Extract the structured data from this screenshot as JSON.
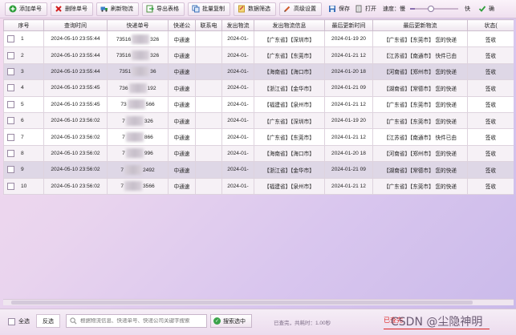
{
  "toolbar": {
    "add": "添加单号",
    "delete": "删除单号",
    "refresh": "刷新物流",
    "export": "导出表格",
    "batch_copy": "批量复制",
    "filter": "数据筛选",
    "advanced": "高级设置",
    "save": "保存",
    "open": "打开",
    "speed_label": "速度：慢",
    "speed_fast": "快",
    "speed_level": 0.1,
    "confirm": "确",
    "colors": {
      "add": "#2e9e3a",
      "delete": "#d21c1c",
      "accent": "#8a6fb0"
    }
  },
  "table": {
    "headers": [
      "序号",
      "查询时间",
      "快递单号",
      "快递公",
      "联系电",
      "发出物流",
      "发出物流信息",
      "最后更新时间",
      "最后更新物流",
      "状态("
    ],
    "rows": [
      {
        "no": "1",
        "time": "2024-05-10 23:55:44",
        "track_a": "73516",
        "track_b": "326",
        "courier": "中通速",
        "phone": "",
        "sent": "2024-01-",
        "sent_info": "【广东省】【深圳市】",
        "last_time": "2024-01-19 20",
        "last_info": "【广东省】【东莞市】 您的快递",
        "status": "签收"
      },
      {
        "no": "2",
        "time": "2024-05-10 23:55:44",
        "track_a": "73516",
        "track_b": "326",
        "courier": "中通速",
        "phone": "",
        "sent": "2024-01-",
        "sent_info": "【广东省】【东莞市】",
        "last_time": "2024-01-21 12",
        "last_info": "【江苏省】【南通市】 快件已由",
        "status": "签收"
      },
      {
        "no": "3",
        "time": "2024-05-10 23:55:44",
        "track_a": "7351",
        "track_b": "36",
        "courier": "中通速",
        "phone": "",
        "sent": "2024-01-",
        "sent_info": "【海南省】【海口市】",
        "last_time": "2024-01-20 18",
        "last_info": "【河南省】【郑州市】 您的快递",
        "status": "签收"
      },
      {
        "no": "4",
        "time": "2024-05-10 23:55:45",
        "track_a": "736",
        "track_b": "192",
        "courier": "中通速",
        "phone": "",
        "sent": "2024-01-",
        "sent_info": "【浙江省】【金华市】",
        "last_time": "2024-01-21 09",
        "last_info": "【湖南省】【常德市】 您的快递",
        "status": "签收"
      },
      {
        "no": "5",
        "time": "2024-05-10 23:55:45",
        "track_a": "73",
        "track_b": "566",
        "courier": "中通速",
        "phone": "",
        "sent": "2024-01-",
        "sent_info": "【福建省】【泉州市】",
        "last_time": "2024-01-21 12",
        "last_info": "【广东省】【东莞市】 您的快递",
        "status": "签收"
      },
      {
        "no": "6",
        "time": "2024-05-10 23:56:02",
        "track_a": "7",
        "track_b": "326",
        "courier": "中通速",
        "phone": "",
        "sent": "2024-01-",
        "sent_info": "【广东省】【深圳市】",
        "last_time": "2024-01-19 20",
        "last_info": "【广东省】【东莞市】 您的快递",
        "status": "签收"
      },
      {
        "no": "7",
        "time": "2024-05-10 23:56:02",
        "track_a": "7",
        "track_b": "866",
        "courier": "中通速",
        "phone": "",
        "sent": "2024-01-",
        "sent_info": "【广东省】【东莞市】",
        "last_time": "2024-01-21 12",
        "last_info": "【江苏省】【南通市】 快件已由",
        "status": "签收"
      },
      {
        "no": "8",
        "time": "2024-05-10 23:56:02",
        "track_a": "7",
        "track_b": "996",
        "courier": "中通速",
        "phone": "",
        "sent": "2024-01-",
        "sent_info": "【海南省】【海口市】",
        "last_time": "2024-01-20 18",
        "last_info": "【河南省】【郑州市】 您的快递",
        "status": "签收"
      },
      {
        "no": "9",
        "time": "2024-05-10 23:56:02",
        "track_a": "7",
        "track_b": "2492",
        "courier": "中通速",
        "phone": "",
        "sent": "2024-01-",
        "sent_info": "【浙江省】【金华市】",
        "last_time": "2024-01-21 09",
        "last_info": "【湖南省】【常德市】 您的快递",
        "status": "签收"
      },
      {
        "no": "10",
        "time": "2024-05-10 23:56:02",
        "track_a": "7",
        "track_b": "3566",
        "courier": "中通速",
        "phone": "",
        "sent": "2024-01-",
        "sent_info": "【福建省】【泉州市】",
        "last_time": "2024-01-21 12",
        "last_info": "【广东省】【东莞市】 您的快递",
        "status": "签收"
      }
    ]
  },
  "bottom": {
    "select_all": "全选",
    "invert": "反选",
    "search_placeholder": "根据物流信息、快递单号、快递公司关键字搜索",
    "search_button": "搜索选中",
    "status": "已查完，共耗时：1.00秒",
    "watermark_red": "已查完",
    "watermark": "CSDN @尘隐神明"
  }
}
